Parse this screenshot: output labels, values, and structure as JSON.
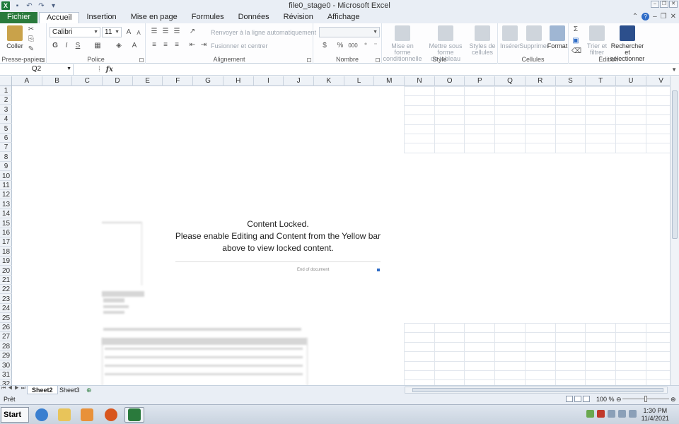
{
  "window": {
    "title": "file0_stage0 - Microsoft Excel"
  },
  "tabs": [
    {
      "label": "Fichier"
    },
    {
      "label": "Accueil"
    },
    {
      "label": "Insertion"
    },
    {
      "label": "Mise en page"
    },
    {
      "label": "Formules"
    },
    {
      "label": "Données"
    },
    {
      "label": "Révision"
    },
    {
      "label": "Affichage"
    }
  ],
  "ribbon": {
    "clipboard": {
      "label": "Presse-papiers",
      "paste": "Coller"
    },
    "font": {
      "label": "Police",
      "name": "Calibri",
      "size": "11",
      "bold": "G",
      "italic": "I",
      "underline": "S"
    },
    "alignment": {
      "label": "Alignement",
      "wrap": "Renvoyer à la ligne automatiquement",
      "merge": "Fusionner et centrer"
    },
    "number": {
      "label": "Nombre",
      "currency": "$",
      "percent": "%",
      "thousands": "000"
    },
    "style": {
      "label": "Style",
      "conditional": [
        "Mise en forme",
        "conditionnelle"
      ],
      "table": [
        "Mettre sous forme",
        "de tableau"
      ],
      "cellstyles": [
        "Styles de",
        "cellules"
      ]
    },
    "cells": {
      "label": "Cellules",
      "insert": "Insérer",
      "delete": "Supprimer",
      "format": "Format"
    },
    "editing": {
      "label": "Édition",
      "sort": [
        "Trier et",
        "filtrer"
      ],
      "find": [
        "Rechercher et",
        "sélectionner"
      ],
      "sum": "Σ"
    }
  },
  "formula_bar": {
    "name_box": "Q2",
    "fx": "fx",
    "value": ""
  },
  "columns": [
    "A",
    "B",
    "C",
    "D",
    "E",
    "F",
    "G",
    "H",
    "I",
    "J",
    "K",
    "L",
    "M",
    "N",
    "O",
    "P",
    "Q",
    "R",
    "S",
    "T",
    "U",
    "V"
  ],
  "rows": [
    "1",
    "2",
    "3",
    "4",
    "5",
    "6",
    "7",
    "8",
    "9",
    "10",
    "11",
    "12",
    "13",
    "14",
    "15",
    "16",
    "17",
    "18",
    "19",
    "20",
    "21",
    "22",
    "23",
    "24",
    "25",
    "26",
    "27",
    "28",
    "29",
    "30",
    "31",
    "32"
  ],
  "document": {
    "locked_lines": [
      "Content Locked.",
      "Please enable Editing and Content from the Yellow bar",
      "above to view locked content."
    ],
    "end_of_document": "End of document"
  },
  "sheets": [
    {
      "label": "Sheet2",
      "active": true
    },
    {
      "label": "Sheet3",
      "active": false
    }
  ],
  "status": {
    "ready": "Prêt",
    "zoom": "100 %"
  },
  "taskbar": {
    "start": "Start",
    "time": "1:30 PM",
    "date": "11/4/2021"
  },
  "colors": {
    "excel_green": "#2a7a3c",
    "accent_blue": "#2f6cc7"
  }
}
